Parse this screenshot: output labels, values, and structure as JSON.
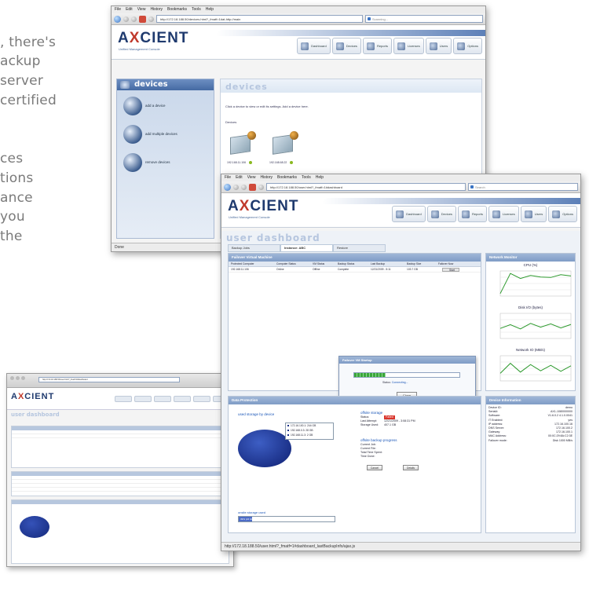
{
  "brochure": {
    "lines": [
      ", there's",
      "ackup",
      "server",
      "certified",
      "ces",
      "tions",
      "ance",
      "you",
      "the"
    ]
  },
  "browser": {
    "menu": [
      "File",
      "Edit",
      "View",
      "History",
      "Bookmarks",
      "Tools",
      "Help"
    ]
  },
  "devices_window": {
    "url": "http://172.18.188.50/devices.html?_fmatf=1#at-http://main",
    "search_placeholder": "Scanning...",
    "logo": "AXCIENT",
    "logo_sub": "Unified Management Console",
    "toolbar": [
      "Dashboard",
      "Devices",
      "Reports",
      "Licenses",
      "Users",
      "Options"
    ],
    "sidebar_title": "devices",
    "sidebar_items": [
      "add a device",
      "add multiple devices",
      "remove devices"
    ],
    "page_title": "devices",
    "note": "Click a device to view or edit its settings. Add a device here.",
    "group_label": "Devices",
    "devices": [
      {
        "label": "192.168.11.106"
      },
      {
        "label": "192.168.68.22"
      }
    ],
    "status": "Done"
  },
  "mini_window": {
    "url": "http://172.18.188.50/user.html?_fmatf=1#dashboard",
    "logo": "AXCIENT",
    "title": "user dashboard"
  },
  "dash_window": {
    "url": "http://172.18.188.50/user.html?_fmatf=1#dashboard",
    "search_placeholder": "Search",
    "logo": "AXCIENT",
    "logo_sub": "Unified Management Console",
    "toolbar": [
      "Dashboard",
      "Devices",
      "Reports",
      "Licenses",
      "Users",
      "Options"
    ],
    "page_title": "user dashboard",
    "tabs": [
      "Backup Jobs",
      "Instance: ABC",
      "Restore"
    ],
    "table_panel_title": "Failover Virtual Machine",
    "table_headers": [
      "Protected Computer",
      "Computer Status",
      "VM Status",
      "Backup Status",
      "Last Backup",
      "Backup Size",
      "Failover Now"
    ],
    "table_row": [
      "192.168.11.106",
      "Online",
      "Offline",
      "Complete",
      "12/21/2009 - 5:11",
      "103.7 GB",
      "Start"
    ],
    "dialog": {
      "title": "Failover VM Startup",
      "progress": 0.3,
      "status_label": "Status:",
      "status_link": "Connecting...",
      "button": "Close"
    },
    "charts_panel_title": "Network Monitor",
    "charts": [
      {
        "title": "CPU (%)",
        "values": [
          10,
          90,
          70,
          82,
          76,
          74,
          85,
          80
        ]
      },
      {
        "title": "Disk I/O (bytes)",
        "values": [
          40,
          55,
          38,
          60,
          45,
          58,
          42,
          56
        ]
      },
      {
        "title": "Network IO (MB/s)",
        "values": [
          30,
          70,
          35,
          65,
          40,
          62,
          38,
          60
        ]
      }
    ],
    "storage_panel_title": "Data Protection",
    "storage_title": "used storage by device",
    "legend": [
      "172.16.100.1: 244 GB",
      "192.168.0.3: 28 GB",
      "192.168.11.3: 2 GB"
    ],
    "status_block": {
      "title": "offsite storage",
      "rows": [
        {
          "k": "Status:",
          "v": "Failed"
        },
        {
          "k": "Last Attempt:",
          "v": "12/21/2009 - 3:08:31 PM"
        },
        {
          "k": "Storage Used:",
          "v": "407.1 GB"
        }
      ]
    },
    "backup_block": {
      "title": "offsite backup progress",
      "rows": [
        "Current Job:",
        "Current File:",
        "Total Time Spent:",
        "Time Done:"
      ],
      "buttons": [
        "Cancel",
        "Details"
      ]
    },
    "usage_label": "onsite storage used",
    "usage_value": "39% (24 GB)",
    "usage_fraction": 0.14,
    "sysinfo_title": "Device Information",
    "sysinfo": [
      {
        "k": "Device ID:",
        "v": "demo"
      },
      {
        "k": "Serial#:",
        "v": "AX1-1080000000"
      },
      {
        "k": "Software:",
        "v": "V1.6.0.2 4.1.0.0041"
      },
      {
        "k": "IT Enabled:",
        "v": "yes"
      },
      {
        "k": "IP address:",
        "v": "172.16.100.16"
      },
      {
        "k": "DNS Server:",
        "v": "172.16.100.2"
      },
      {
        "k": "Gateway:",
        "v": "172.16.100.1"
      },
      {
        "k": "MAC Address:",
        "v": "00:0C:29:8A:C2:3E"
      },
      {
        "k": "Failover mode:",
        "v": "Disk 1000 MB/s"
      }
    ],
    "status": "http://172.18.188.50/user.html?_fmatf=1#dashboard_lastBackupInfo/ajax.js"
  }
}
